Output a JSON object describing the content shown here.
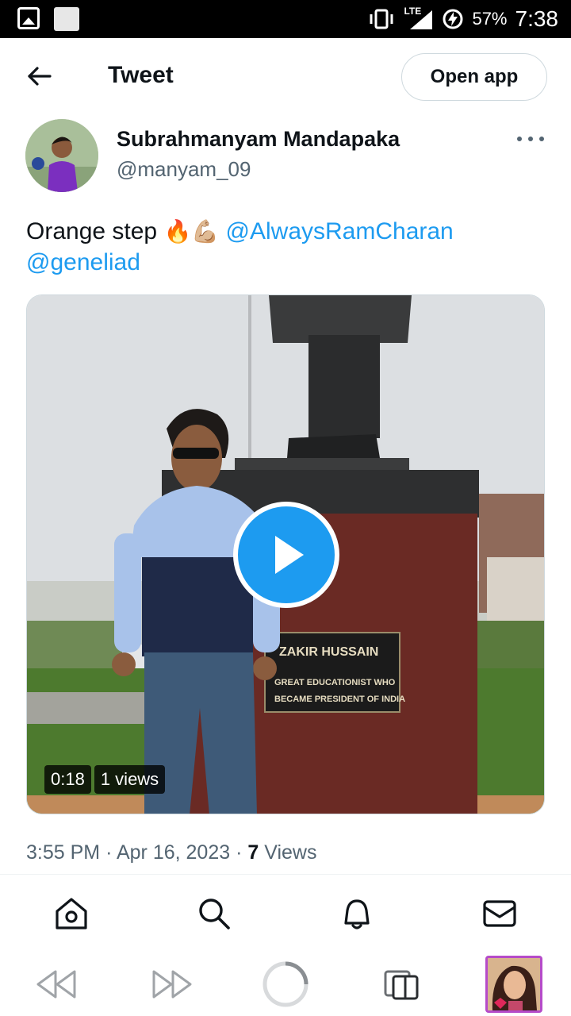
{
  "status_bar": {
    "network": "LTE",
    "battery": "57%",
    "time": "7:38"
  },
  "header": {
    "title": "Tweet",
    "open_app_label": "Open app"
  },
  "author": {
    "name": "Subrahmanyam Mandapaka",
    "handle": "@manyam_09"
  },
  "tweet": {
    "text": "Orange step",
    "emojis": "🔥💪🏼",
    "mentions": [
      "@AlwaysRamCharan",
      "@geneliad"
    ]
  },
  "media": {
    "duration": "0:18",
    "views_badge": "1 views",
    "plaque_title": "ZAKIR HUSSAIN",
    "plaque_line1": "GREAT EDUCATIONIST WHO",
    "plaque_line2": "BECAME PRESIDENT OF INDIA"
  },
  "meta": {
    "time": "3:55 PM",
    "separator": "·",
    "date": "Apr 16, 2023",
    "views_count": "7",
    "views_label": "Views"
  },
  "bottom_nav": [
    "home-icon",
    "search-icon",
    "bell-icon",
    "mail-icon"
  ],
  "browser_bar": [
    "rewind-icon",
    "forward-icon",
    "loading-icon",
    "tabs-icon",
    "tab-thumbnail"
  ],
  "colors": {
    "accent": "#1d9bf0",
    "text": "#0f1419",
    "secondary_text": "#536471",
    "border": "#cfd9de"
  }
}
